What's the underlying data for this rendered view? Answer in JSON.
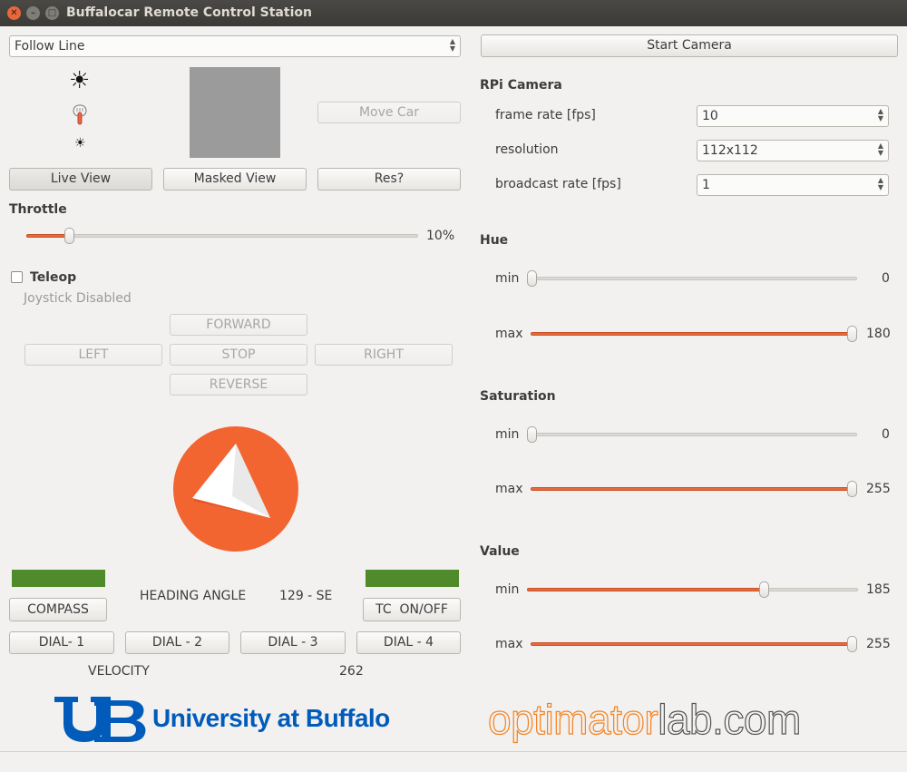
{
  "window": {
    "title": "Buffalocar Remote Control Station",
    "close_glyph": "✕",
    "min_glyph": "–",
    "max_glyph": "□"
  },
  "mode_select": {
    "value": "Follow Line"
  },
  "icons": {
    "brightness_high": "☀",
    "brightness_low": "☀"
  },
  "move_car": {
    "label": "Move Car"
  },
  "views": {
    "live": "Live View",
    "masked": "Masked View",
    "res": "Res?"
  },
  "throttle": {
    "label": "Throttle",
    "value_text": "10%",
    "value": 0.1
  },
  "teleop": {
    "label": "Teleop",
    "checked": false,
    "joystick_status": "Joystick Disabled"
  },
  "drive": {
    "forward": "FORWARD",
    "left": "LEFT",
    "stop": "STOP",
    "right": "RIGHT",
    "reverse": "REVERSE"
  },
  "compass": {
    "label": "COMPASS",
    "heading_label": "HEADING ANGLE",
    "heading_value": "129 - SE",
    "tc_label": "TC  ON/OFF",
    "accent": "#f26430",
    "status_color": "#4f8a2b"
  },
  "dials": [
    "DIAL- 1",
    "DIAL - 2",
    "DIAL - 3",
    "DIAL - 4"
  ],
  "velocity": {
    "label": "VELOCITY",
    "value": "262"
  },
  "logos": {
    "ub_text": "University at Buffalo",
    "ub_color": "#005bbb",
    "optimator_part1": "optimator",
    "optimator_part2": "lab.com",
    "optimator_color": "#f58220"
  },
  "camera": {
    "start_label": "Start Camera",
    "section_title": "RPi Camera",
    "frame_rate": {
      "label": "frame rate [fps]",
      "value": "10"
    },
    "resolution": {
      "label": "resolution",
      "value": "112x112"
    },
    "broadcast_rate": {
      "label": "broadcast rate [fps]",
      "value": "1"
    }
  },
  "hue": {
    "title": "Hue",
    "min_label": "min",
    "min_value": "0",
    "max_label": "max",
    "max_value": "180"
  },
  "saturation": {
    "title": "Saturation",
    "min_label": "min",
    "min_value": "0",
    "max_label": "max",
    "max_value": "255"
  },
  "value_hsv": {
    "title": "Value",
    "min_label": "min",
    "min_value": "185",
    "max_label": "max",
    "max_value": "255"
  }
}
